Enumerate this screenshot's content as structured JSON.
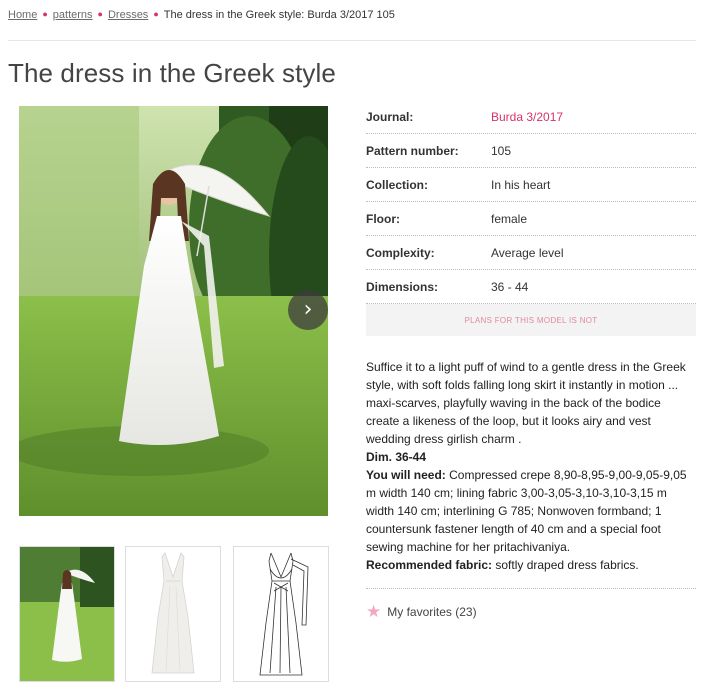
{
  "breadcrumb": {
    "home": "Home",
    "patterns": "patterns",
    "dresses": "Dresses",
    "current": "The dress in the Greek style: Burda 3/2017 105"
  },
  "page_title": "The dress in the Greek style",
  "gallery": {
    "next_icon": "chevron-right-icon",
    "next_glyph": "›",
    "thumbnails": [
      "photo",
      "front-view",
      "technical-drawing"
    ]
  },
  "details": {
    "journal_label": "Journal:",
    "journal_value": "Burda 3/2017",
    "pattern_label": "Pattern number:",
    "pattern_value": "105",
    "collection_label": "Collection:",
    "collection_value": "In his heart",
    "floor_label": "Floor:",
    "floor_value": "female",
    "complexity_label": "Complexity:",
    "complexity_value": "Average level",
    "dimensions_label": "Dimensions:",
    "dimensions_value": "36 - 44"
  },
  "plans_text": "PLANS FOR THIS MODEL IS NOT",
  "description": {
    "intro": "Suffice it to a light puff of wind to a gentle dress in the Greek style, with soft folds falling long skirt it instantly in motion ... maxi-scarves, playfully waving in the back of the bodice create a likeness of the loop, but it looks airy and vest wedding dress girlish charm .",
    "dim": "Dim. 36-44",
    "need_label": "You will need:",
    "need_text": " Compressed crepe 8,90-8,95-9,00-9,05-9,05 m width 140 cm; lining fabric 3,00-3,05-3,10-3,10-3,15 m width 140 cm; interlining G 785; Nonwoven formband; 1 countersunk fastener length of 40 cm and a special foot sewing machine for her pritachivaniya.",
    "fabric_label": "Recommended fabric:",
    "fabric_text": " softly draped dress fabrics."
  },
  "favorites": {
    "label": "My favorites (23)",
    "icon": "star-icon"
  },
  "colors": {
    "accent": "#d6336c",
    "plans_text": "#e08a9a",
    "star": "#f3a9bd"
  }
}
